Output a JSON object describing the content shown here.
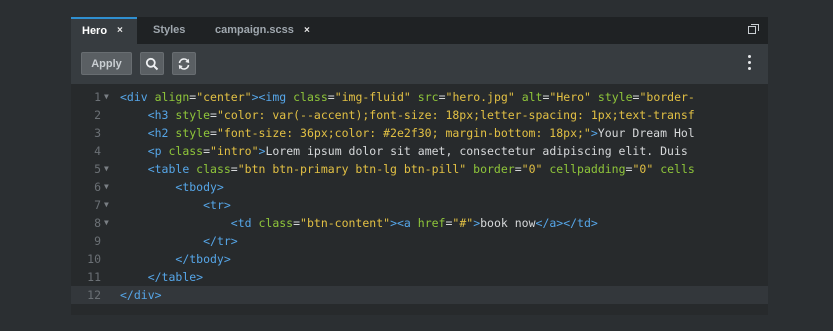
{
  "tabs": [
    {
      "label": "Hero",
      "close": "×",
      "active": true
    },
    {
      "label": "Styles"
    },
    {
      "label": "campaign.scss",
      "close": "×"
    }
  ],
  "toolbar": {
    "apply_label": "Apply",
    "search_icon": "search-icon",
    "replace_icon": "refresh-icon",
    "menu_icon": "more-vertical-icon"
  },
  "colors": {
    "tag": "#56a6e8",
    "attr": "#8fc63a",
    "value": "#e2c044",
    "text": "#d6d8da",
    "accent": "#2f8fd0"
  },
  "code": {
    "current_line": 12,
    "lines": [
      {
        "n": "1",
        "fold": true,
        "tokens": [
          [
            "t",
            "<div "
          ],
          [
            "a",
            "align"
          ],
          [
            "p",
            "="
          ],
          [
            "v",
            "\"center\""
          ],
          [
            "t",
            "><img "
          ],
          [
            "a",
            "class"
          ],
          [
            "p",
            "="
          ],
          [
            "v",
            "\"img-fluid\""
          ],
          [
            "p",
            " "
          ],
          [
            "a",
            "src"
          ],
          [
            "p",
            "="
          ],
          [
            "v",
            "\"hero.jpg\""
          ],
          [
            "p",
            " "
          ],
          [
            "a",
            "alt"
          ],
          [
            "p",
            "="
          ],
          [
            "v",
            "\"Hero\""
          ],
          [
            "p",
            " "
          ],
          [
            "a",
            "style"
          ],
          [
            "p",
            "="
          ],
          [
            "v",
            "\"border-"
          ]
        ]
      },
      {
        "n": "2",
        "fold": false,
        "tokens": [
          [
            "p",
            "    "
          ],
          [
            "t",
            "<h3 "
          ],
          [
            "a",
            "style"
          ],
          [
            "p",
            "="
          ],
          [
            "v",
            "\"color: var(--accent);font-size: 18px;letter-spacing: 1px;text-transf"
          ]
        ]
      },
      {
        "n": "3",
        "fold": false,
        "tokens": [
          [
            "p",
            "    "
          ],
          [
            "t",
            "<h2 "
          ],
          [
            "a",
            "style"
          ],
          [
            "p",
            "="
          ],
          [
            "v",
            "\"font-size: 36px;color: #2e2f30; margin-bottom: 18px;\""
          ],
          [
            "t",
            ">"
          ],
          [
            "p",
            "Your Dream Hol"
          ]
        ]
      },
      {
        "n": "4",
        "fold": false,
        "tokens": [
          [
            "p",
            "    "
          ],
          [
            "t",
            "<p "
          ],
          [
            "a",
            "class"
          ],
          [
            "p",
            "="
          ],
          [
            "v",
            "\"intro\""
          ],
          [
            "t",
            ">"
          ],
          [
            "p",
            "Lorem ipsum dolor sit amet, consectetur adipiscing elit. Duis"
          ]
        ]
      },
      {
        "n": "5",
        "fold": true,
        "tokens": [
          [
            "p",
            "    "
          ],
          [
            "t",
            "<table "
          ],
          [
            "a",
            "class"
          ],
          [
            "p",
            "="
          ],
          [
            "v",
            "\"btn btn-primary btn-lg btn-pill\""
          ],
          [
            "p",
            " "
          ],
          [
            "a",
            "border"
          ],
          [
            "p",
            "="
          ],
          [
            "v",
            "\"0\""
          ],
          [
            "p",
            " "
          ],
          [
            "a",
            "cellpadding"
          ],
          [
            "p",
            "="
          ],
          [
            "v",
            "\"0\""
          ],
          [
            "p",
            " "
          ],
          [
            "a",
            "cells"
          ]
        ]
      },
      {
        "n": "6",
        "fold": true,
        "tokens": [
          [
            "p",
            "        "
          ],
          [
            "t",
            "<tbody>"
          ]
        ]
      },
      {
        "n": "7",
        "fold": true,
        "tokens": [
          [
            "p",
            "            "
          ],
          [
            "t",
            "<tr>"
          ]
        ]
      },
      {
        "n": "8",
        "fold": true,
        "tokens": [
          [
            "p",
            "                "
          ],
          [
            "t",
            "<td "
          ],
          [
            "a",
            "class"
          ],
          [
            "p",
            "="
          ],
          [
            "v",
            "\"btn-content\""
          ],
          [
            "t",
            "><a "
          ],
          [
            "a",
            "href"
          ],
          [
            "p",
            "="
          ],
          [
            "v",
            "\"#\""
          ],
          [
            "t",
            ">"
          ],
          [
            "p",
            "book now"
          ],
          [
            "t",
            "</a></td>"
          ]
        ]
      },
      {
        "n": "9",
        "fold": false,
        "tokens": [
          [
            "p",
            "            "
          ],
          [
            "t",
            "</tr>"
          ]
        ]
      },
      {
        "n": "10",
        "fold": false,
        "tokens": [
          [
            "p",
            "        "
          ],
          [
            "t",
            "</tbody>"
          ]
        ]
      },
      {
        "n": "11",
        "fold": false,
        "tokens": [
          [
            "p",
            "    "
          ],
          [
            "t",
            "</table>"
          ]
        ]
      },
      {
        "n": "12",
        "fold": false,
        "tokens": [
          [
            "t",
            "</div>"
          ]
        ]
      }
    ]
  }
}
